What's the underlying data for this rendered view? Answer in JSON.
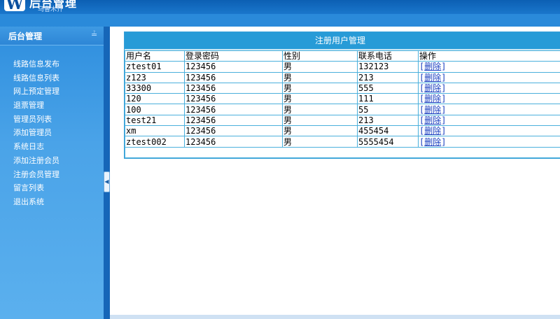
{
  "header": {
    "logo_letter": "W",
    "title": "后台管理",
    "subtitle": "乌鲁木齐"
  },
  "sidebar": {
    "title": "后台管理",
    "toggle_icon": "chevron-double-down",
    "items": [
      {
        "label": "线路信息发布"
      },
      {
        "label": "线路信息列表"
      },
      {
        "label": "网上预定管理"
      },
      {
        "label": "退票管理"
      },
      {
        "label": "管理员列表"
      },
      {
        "label": "添加管理员"
      },
      {
        "label": "系统日志"
      },
      {
        "label": "添加注册会员"
      },
      {
        "label": "注册会员管理"
      },
      {
        "label": "留言列表"
      },
      {
        "label": "退出系统"
      }
    ]
  },
  "splitter": {
    "icon": "collapse-left-arrow"
  },
  "panel": {
    "title": "注册用户管理",
    "columns": [
      "用户名",
      "登录密码",
      "性别",
      "联系电话",
      "操作"
    ],
    "rows": [
      {
        "username": "ztest01",
        "password": "123456",
        "gender": "男",
        "phone": "132123",
        "action": "删除"
      },
      {
        "username": "z123",
        "password": "123456",
        "gender": "男",
        "phone": "213",
        "action": "删除"
      },
      {
        "username": "33300",
        "password": "123456",
        "gender": "男",
        "phone": "555",
        "action": "删除"
      },
      {
        "username": "120",
        "password": "123456",
        "gender": "男",
        "phone": "111",
        "action": "删除"
      },
      {
        "username": "100",
        "password": "123456",
        "gender": "男",
        "phone": "55",
        "action": "删除"
      },
      {
        "username": "test21",
        "password": "123456",
        "gender": "男",
        "phone": "213",
        "action": "删除"
      },
      {
        "username": "xm",
        "password": "123456",
        "gender": "男",
        "phone": "455454",
        "action": "删除"
      },
      {
        "username": "ztest002",
        "password": "123456",
        "gender": "男",
        "phone": "5555454",
        "action": "删除"
      }
    ]
  },
  "colors": {
    "header_blue": "#1a77cc",
    "sidebar_blue": "#4aa3e8",
    "panel_header": "#279bd7",
    "grid_border": "#4bb0dc",
    "link": "#1a3fc0"
  }
}
